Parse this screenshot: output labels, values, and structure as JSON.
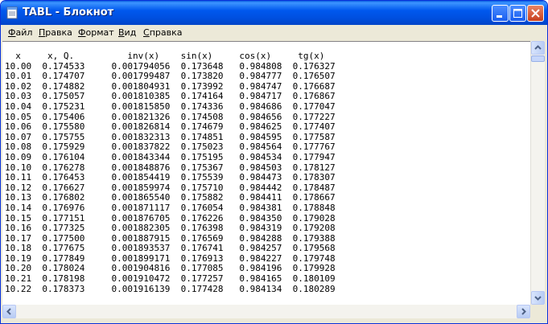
{
  "window": {
    "title": "TABL - Блокнот"
  },
  "menu": [
    {
      "accel": "Ф",
      "rest": "айл"
    },
    {
      "accel": "П",
      "rest": "равка"
    },
    {
      "accel": "Ф",
      "rest": "ормат"
    },
    {
      "accel": "В",
      "rest": "ид"
    },
    {
      "accel": "С",
      "rest": "правка"
    }
  ],
  "table": {
    "headers": [
      "x",
      "x, Q.",
      "inv(x)",
      "sin(x)",
      "cos(x)",
      "tg(x)"
    ],
    "rows": [
      [
        "10.00",
        "0.174533",
        "0.001794056",
        "0.173648",
        "0.984808",
        "0.176327"
      ],
      [
        "10.01",
        "0.174707",
        "0.001799487",
        "0.173820",
        "0.984777",
        "0.176507"
      ],
      [
        "10.02",
        "0.174882",
        "0.001804931",
        "0.173992",
        "0.984747",
        "0.176687"
      ],
      [
        "10.03",
        "0.175057",
        "0.001810385",
        "0.174164",
        "0.984717",
        "0.176867"
      ],
      [
        "10.04",
        "0.175231",
        "0.001815850",
        "0.174336",
        "0.984686",
        "0.177047"
      ],
      [
        "10.05",
        "0.175406",
        "0.001821326",
        "0.174508",
        "0.984656",
        "0.177227"
      ],
      [
        "10.06",
        "0.175580",
        "0.001826814",
        "0.174679",
        "0.984625",
        "0.177407"
      ],
      [
        "10.07",
        "0.175755",
        "0.001832313",
        "0.174851",
        "0.984595",
        "0.177587"
      ],
      [
        "10.08",
        "0.175929",
        "0.001837822",
        "0.175023",
        "0.984564",
        "0.177767"
      ],
      [
        "10.09",
        "0.176104",
        "0.001843344",
        "0.175195",
        "0.984534",
        "0.177947"
      ],
      [
        "10.10",
        "0.176278",
        "0.001848876",
        "0.175367",
        "0.984503",
        "0.178127"
      ],
      [
        "10.11",
        "0.176453",
        "0.001854419",
        "0.175539",
        "0.984473",
        "0.178307"
      ],
      [
        "10.12",
        "0.176627",
        "0.001859974",
        "0.175710",
        "0.984442",
        "0.178487"
      ],
      [
        "10.13",
        "0.176802",
        "0.001865540",
        "0.175882",
        "0.984411",
        "0.178667"
      ],
      [
        "10.14",
        "0.176976",
        "0.001871117",
        "0.176054",
        "0.984381",
        "0.178848"
      ],
      [
        "10.15",
        "0.177151",
        "0.001876705",
        "0.176226",
        "0.984350",
        "0.179028"
      ],
      [
        "10.16",
        "0.177325",
        "0.001882305",
        "0.176398",
        "0.984319",
        "0.179208"
      ],
      [
        "10.17",
        "0.177500",
        "0.001887915",
        "0.176569",
        "0.984288",
        "0.179388"
      ],
      [
        "10.18",
        "0.177675",
        "0.001893537",
        "0.176741",
        "0.984257",
        "0.179568"
      ],
      [
        "10.19",
        "0.177849",
        "0.001899171",
        "0.176913",
        "0.984227",
        "0.179748"
      ],
      [
        "10.20",
        "0.178024",
        "0.001904816",
        "0.177085",
        "0.984196",
        "0.179928"
      ],
      [
        "10.21",
        "0.178198",
        "0.001910472",
        "0.177257",
        "0.984165",
        "0.180109"
      ],
      [
        "10.22",
        "0.178373",
        "0.001916139",
        "0.177428",
        "0.984134",
        "0.180289"
      ]
    ]
  },
  "colors": {
    "titlebar": "#0058ee",
    "close": "#c8401c",
    "face": "#ece9d8"
  },
  "icons": {
    "app": "notepad-icon",
    "min": "minimize-icon",
    "max": "maximize-icon",
    "close": "close-icon"
  }
}
